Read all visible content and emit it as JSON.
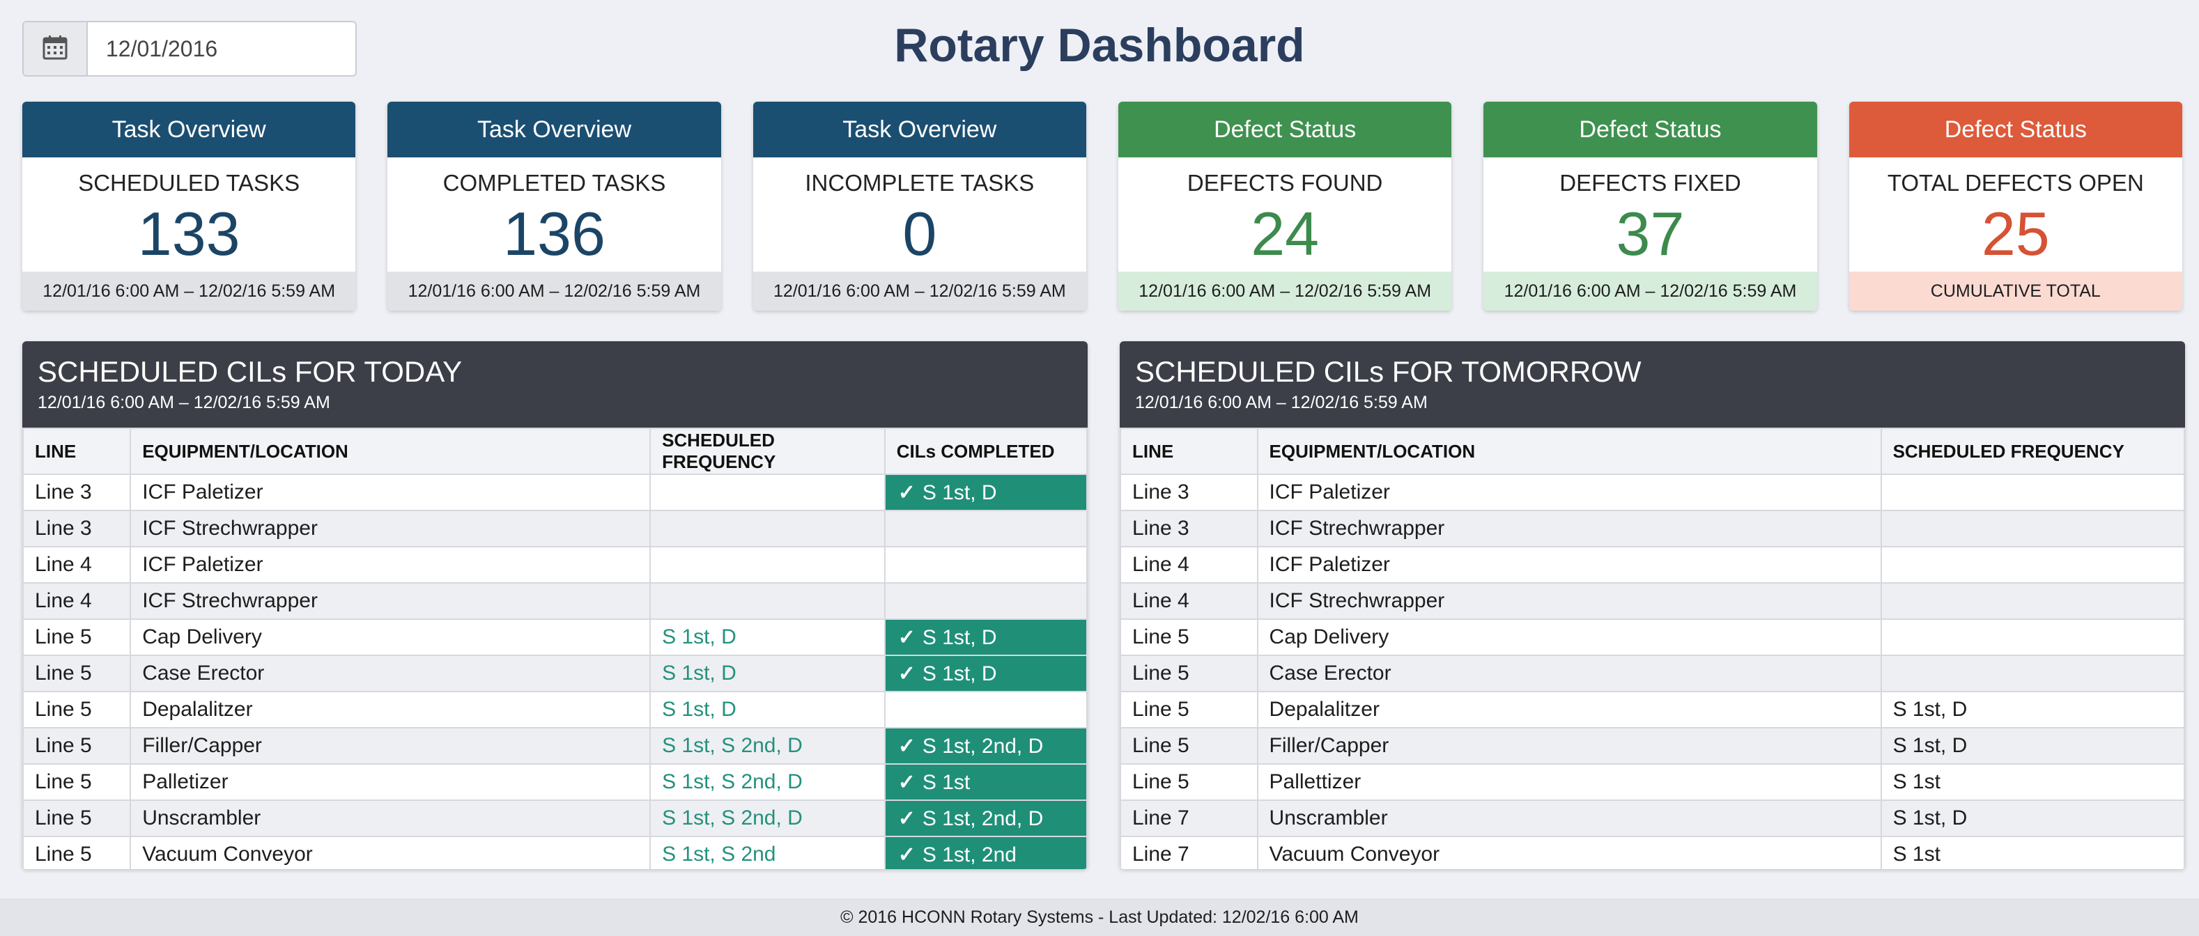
{
  "date_picker": {
    "value": "12/01/2016",
    "icon": "calendar-icon"
  },
  "page_title": "Rotary Dashboard",
  "cards": [
    {
      "header": "Task Overview",
      "label": "SCHEDULED TASKS",
      "value": "133",
      "footer": "12/01/16 6:00 AM – 12/02/16 5:59 AM",
      "theme": "task",
      "color": "#1b4f72"
    },
    {
      "header": "Task Overview",
      "label": "COMPLETED TASKS",
      "value": "136",
      "footer": "12/01/16 6:00 AM – 12/02/16 5:59 AM",
      "theme": "task",
      "color": "#1b4f72"
    },
    {
      "header": "Task Overview",
      "label": "INCOMPLETE TASKS",
      "value": "0",
      "footer": "12/01/16 6:00 AM – 12/02/16 5:59 AM",
      "theme": "task",
      "color": "#1b4f72"
    },
    {
      "header": "Defect Status",
      "label": "DEFECTS FOUND",
      "value": "24",
      "footer": "12/01/16 6:00 AM – 12/02/16 5:59 AM",
      "theme": "defect",
      "color": "#3f9150"
    },
    {
      "header": "Defect Status",
      "label": "DEFECTS FIXED",
      "value": "37",
      "footer": "12/01/16 6:00 AM – 12/02/16 5:59 AM",
      "theme": "defect",
      "color": "#3f9150"
    },
    {
      "header": "Defect Status",
      "label": "TOTAL DEFECTS OPEN",
      "value": "25",
      "footer": "CUMULATIVE TOTAL",
      "theme": "open",
      "color": "#dd5a3b"
    }
  ],
  "today": {
    "title": "SCHEDULED CILs FOR TODAY",
    "subtitle": "12/01/16 6:00 AM – 12/02/16 5:59 AM",
    "columns": [
      "LINE",
      "EQUIPMENT/LOCATION",
      "SCHEDULED FREQUENCY",
      "CILs COMPLETED"
    ],
    "rows": [
      {
        "line": "Line 3",
        "equipment": "ICF Paletizer",
        "frequency": "",
        "completed": "S 1st, D"
      },
      {
        "line": "Line 3",
        "equipment": "ICF Strechwrapper",
        "frequency": "",
        "completed": ""
      },
      {
        "line": "Line 4",
        "equipment": "ICF Paletizer",
        "frequency": "",
        "completed": ""
      },
      {
        "line": "Line 4",
        "equipment": "ICF Strechwrapper",
        "frequency": "",
        "completed": ""
      },
      {
        "line": "Line 5",
        "equipment": "Cap Delivery",
        "frequency": "S 1st, D",
        "completed": "S 1st, D"
      },
      {
        "line": "Line 5",
        "equipment": "Case Erector",
        "frequency": "S 1st, D",
        "completed": "S 1st, D"
      },
      {
        "line": "Line 5",
        "equipment": "Depalalitzer",
        "frequency": "S 1st, D",
        "completed": ""
      },
      {
        "line": "Line 5",
        "equipment": "Filler/Capper",
        "frequency": "S 1st, S 2nd, D",
        "completed": "S 1st, 2nd, D"
      },
      {
        "line": "Line 5",
        "equipment": "Palletizer",
        "frequency": "S 1st, S 2nd, D",
        "completed": "S 1st"
      },
      {
        "line": "Line 5",
        "equipment": "Unscrambler",
        "frequency": "S 1st, S 2nd, D",
        "completed": "S 1st, 2nd, D"
      },
      {
        "line": "Line 5",
        "equipment": "Vacuum Conveyor",
        "frequency": "S 1st, S 2nd",
        "completed": "S 1st, 2nd"
      }
    ]
  },
  "tomorrow": {
    "title": "SCHEDULED CILs FOR TOMORROW",
    "subtitle": "12/01/16 6:00 AM – 12/02/16 5:59 AM",
    "columns": [
      "LINE",
      "EQUIPMENT/LOCATION",
      "SCHEDULED FREQUENCY"
    ],
    "rows": [
      {
        "line": "Line 3",
        "equipment": "ICF Paletizer",
        "frequency": ""
      },
      {
        "line": "Line 3",
        "equipment": "ICF Strechwrapper",
        "frequency": ""
      },
      {
        "line": "Line 4",
        "equipment": "ICF Paletizer",
        "frequency": ""
      },
      {
        "line": "Line 4",
        "equipment": "ICF Strechwrapper",
        "frequency": ""
      },
      {
        "line": "Line 5",
        "equipment": "Cap Delivery",
        "frequency": ""
      },
      {
        "line": "Line 5",
        "equipment": "Case Erector",
        "frequency": ""
      },
      {
        "line": "Line 5",
        "equipment": "Depalalitzer",
        "frequency": "S 1st, D"
      },
      {
        "line": "Line 5",
        "equipment": "Filler/Capper",
        "frequency": "S 1st, D"
      },
      {
        "line": "Line 5",
        "equipment": "Pallettizer",
        "frequency": "S 1st"
      },
      {
        "line": "Line 7",
        "equipment": "Unscrambler",
        "frequency": "S 1st, D"
      },
      {
        "line": "Line 7",
        "equipment": "Vacuum Conveyor",
        "frequency": "S 1st"
      }
    ]
  },
  "colors": {
    "completed_cell": "#1f8f78",
    "frequency_text": "#23917e",
    "panel_header": "#3c3f48"
  },
  "footer": "© 2016 HCONN Rotary Systems - Last Updated: 12/02/16 6:00 AM"
}
